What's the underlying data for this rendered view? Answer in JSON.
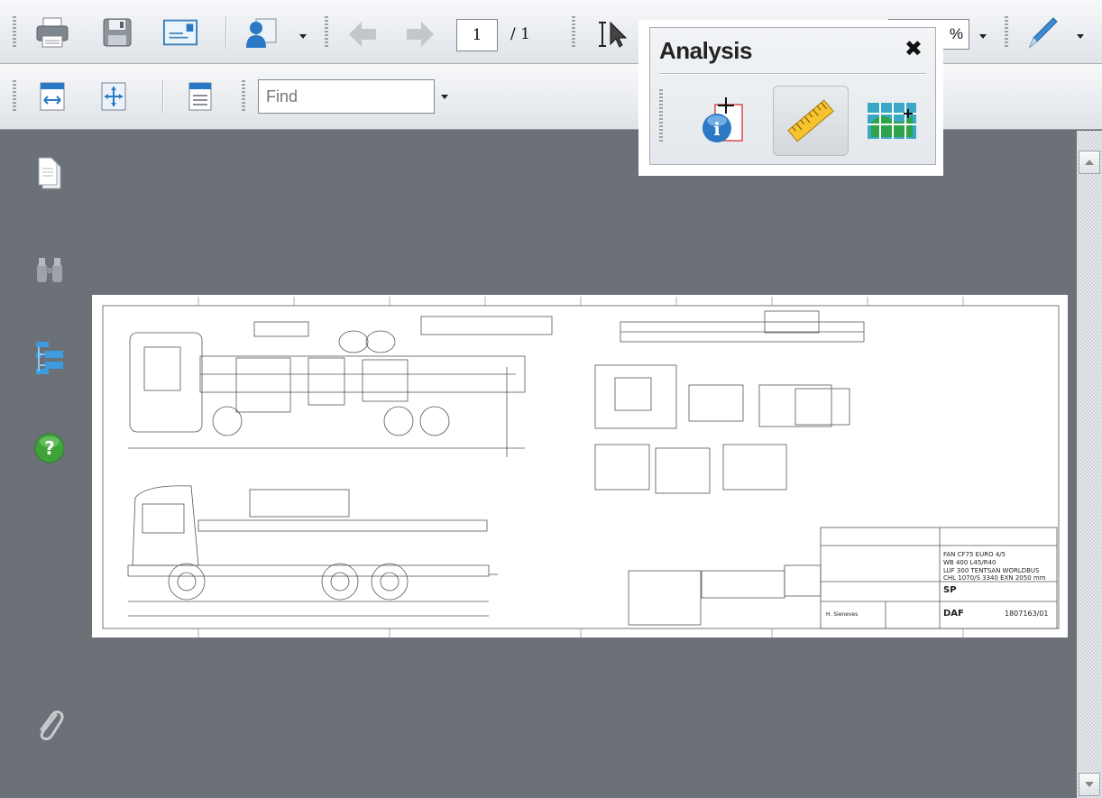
{
  "toolbar": {
    "page_current": "1",
    "page_total": "/ 1",
    "zoom_value": "%",
    "find_placeholder": "Find",
    "icons": [
      "print-icon",
      "save-icon",
      "email-icon",
      "collaborate-icon",
      "previous-page-icon",
      "next-page-icon",
      "select-tool-icon",
      "zoom-dropdown-icon",
      "sign-pen-icon",
      "fit-width-icon",
      "fit-page-icon",
      "single-page-icon"
    ]
  },
  "nav_panel": {
    "icons": [
      "pages-icon",
      "search-binoculars-icon",
      "bookmarks-tree-icon",
      "help-icon",
      "attachments-paperclip-icon"
    ]
  },
  "analysis_panel": {
    "title": "Analysis",
    "close_glyph": "✖",
    "tools": [
      "object-data-tool-icon",
      "measuring-tool-icon",
      "geospatial-location-tool-icon"
    ],
    "active_tool_index": 1
  },
  "document": {
    "title_block_line1": "FAN CF75 EURO 4/5",
    "title_block_line2": "WB 400 L45/R40",
    "title_block_line3": "LUF 300 TENTSAN WORLDBUS",
    "title_block_line4": "CHL 1070/S 3340 EXN 2050 mm",
    "sheet_code": "SP",
    "brand_mark": "DAF",
    "drawing_number": "1807163/01",
    "drawer_name": "H. Sieneves"
  },
  "colors": {
    "background": "#6b7176",
    "toolbar": "#e6e9ed",
    "accent_blue": "#2b78c4",
    "help_green": "#3fa33a"
  }
}
